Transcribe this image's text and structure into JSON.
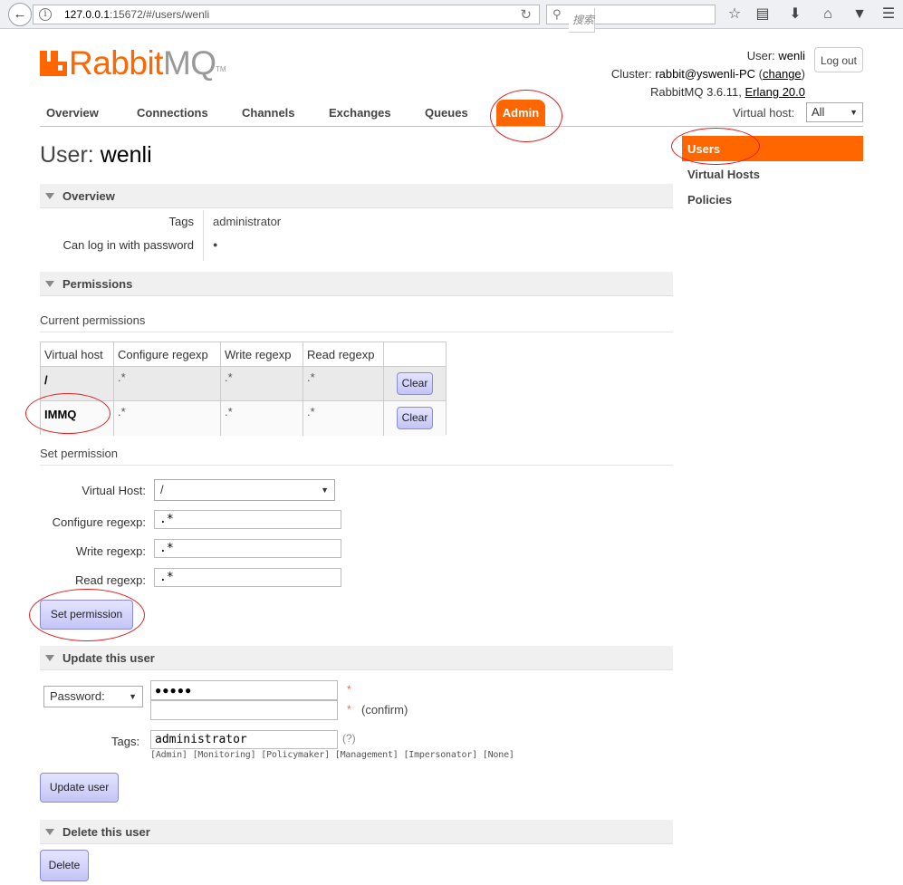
{
  "browser": {
    "url_host": "127.0.0.1",
    "url_rest": ":15672/#/users/wenli",
    "search_placeholder": "搜索"
  },
  "brand": {
    "name_a": "Rabbit",
    "name_b": "MQ",
    "tm": "TM",
    "accent": "#ff6600"
  },
  "header": {
    "user_prefix": "User: ",
    "user_name": "wenli",
    "cluster_prefix": "Cluster: ",
    "cluster_name": "rabbit@yswenli-PC",
    "change_open": " (",
    "change_label": "change",
    "change_close": ")",
    "version_prefix": "RabbitMQ 3.6.11, ",
    "erlang": "Erlang 20.0",
    "logout_label": "Log out",
    "vhost_label": "Virtual host:",
    "vhost_value": "All"
  },
  "nav": {
    "items": [
      "Overview",
      "Connections",
      "Channels",
      "Exchanges",
      "Queues"
    ],
    "active": "Admin"
  },
  "sidebar": {
    "items": [
      "Users",
      "Virtual Hosts",
      "Policies"
    ]
  },
  "page": {
    "title_prefix": "User:",
    "title_name": "wenli"
  },
  "overview": {
    "heading": "Overview",
    "rows": [
      {
        "label": "Tags",
        "value": "administrator"
      },
      {
        "label": "Can log in with password",
        "value": "●"
      }
    ]
  },
  "permissions": {
    "heading": "Permissions",
    "current_label": "Current permissions",
    "columns": [
      "Virtual host",
      "Configure regexp",
      "Write regexp",
      "Read regexp"
    ],
    "rows": [
      {
        "vhost": "/",
        "configure": ".*",
        "write": ".*",
        "read": ".*",
        "action": "Clear"
      },
      {
        "vhost": "IMMQ",
        "configure": ".*",
        "write": ".*",
        "read": ".*",
        "action": "Clear"
      }
    ],
    "set_label": "Set permission",
    "form": {
      "vhost_label": "Virtual Host:",
      "vhost_value": "/",
      "configure_label": "Configure regexp:",
      "configure_value": ".*",
      "write_label": "Write regexp:",
      "write_value": ".*",
      "read_label": "Read regexp:",
      "read_value": ".*",
      "submit_label": "Set permission"
    }
  },
  "update": {
    "heading": "Update this user",
    "password_select": "Password:",
    "password_value": "●●●●●",
    "required_mark": "*",
    "confirm_label": "(confirm)",
    "tags_label": "Tags:",
    "tags_value": "administrator",
    "tags_help": "(?)",
    "tag_options": [
      "[Admin]",
      "[Monitoring]",
      "[Policymaker]",
      "[Management]",
      "[Impersonator]",
      "[None]"
    ],
    "submit_label": "Update user"
  },
  "delete": {
    "heading": "Delete this user",
    "button_label": "Delete"
  },
  "icons": [
    "back-arrow-icon",
    "info-icon",
    "reload-icon",
    "search-icon",
    "bookmark-star-icon",
    "reading-list-icon",
    "download-icon",
    "home-icon",
    "pocket-icon",
    "menu-icon"
  ]
}
